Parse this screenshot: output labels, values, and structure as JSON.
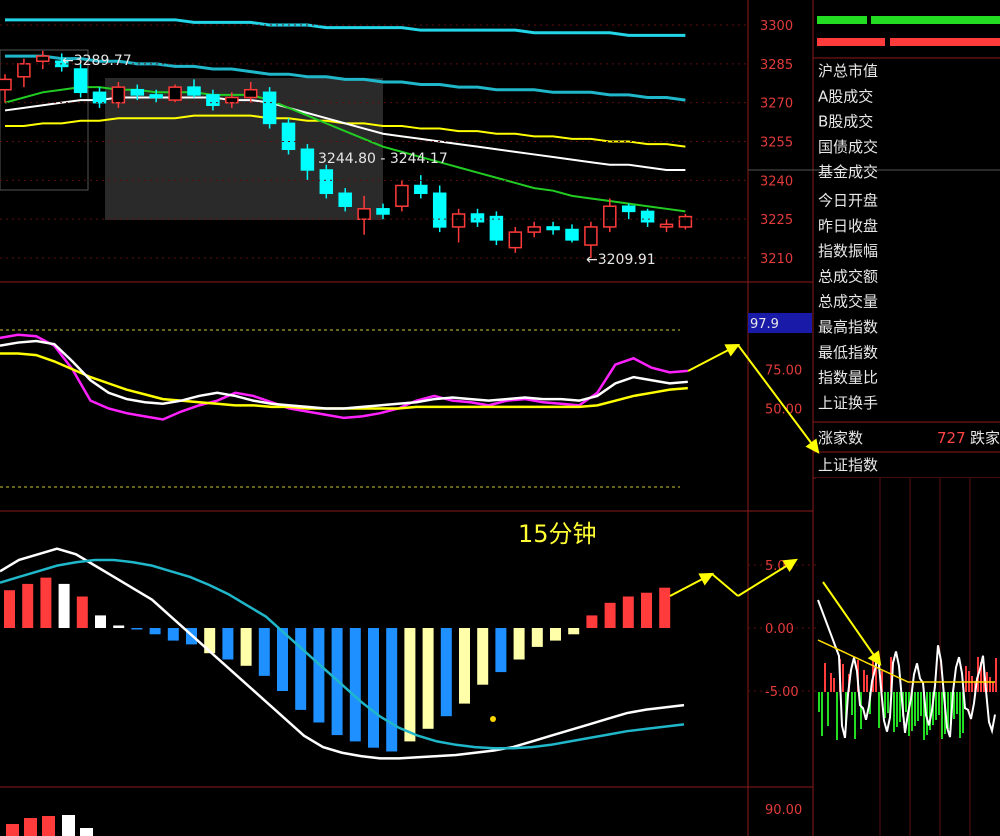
{
  "colors": {
    "grid": "#8b1a1a",
    "up": "#ff3b3b",
    "down": "#00ffff",
    "ma_white": "#ffffff",
    "ma_yellow": "#ffff00",
    "ma_green": "#22cc22",
    "ma_cyan": "#1fb7c9",
    "kdj_magenta": "#ff22ff",
    "macd_blue": "#1e90ff",
    "macd_paleyellow": "#ffffaa",
    "arrow_yellow": "#ffff00"
  },
  "price_axis": {
    "ticks": [
      "3300",
      "3285",
      "3270",
      "3255",
      "3240",
      "3225",
      "3210"
    ]
  },
  "annotations": {
    "high": "3289.77",
    "mid": "3244.80 - 3244.17",
    "low": "3209.91",
    "timeframe": "15分钟"
  },
  "kdj_axis": {
    "ticks": [
      "75.00",
      "50.00"
    ],
    "current": "97.9"
  },
  "macd_axis": {
    "ticks": [
      "5.00",
      "0.00",
      "-5.00"
    ]
  },
  "vol_axis": {
    "ticks": [
      "90.00"
    ]
  },
  "info_panel": {
    "rows": [
      "沪总市值",
      "A股成交",
      "B股成交",
      "国债成交",
      "基金成交",
      "今日开盘",
      "昨日收盘",
      "指数振幅",
      "总成交额",
      "总成交量",
      "最高指数",
      "最低指数",
      "指数量比",
      "上证换手"
    ],
    "rise_label": "涨家数",
    "rise_value": "727",
    "fall_label": "跌家",
    "mini_title": "上证指数"
  },
  "chart_data": [
    {
      "type": "candlestick",
      "title": "",
      "ylim": [
        3205,
        3305
      ],
      "candles": [
        {
          "o": 3275,
          "h": 3281,
          "l": 3270,
          "c": 3279
        },
        {
          "o": 3280,
          "h": 3287,
          "l": 3276,
          "c": 3285
        },
        {
          "o": 3286,
          "h": 3290,
          "l": 3283,
          "c": 3288
        },
        {
          "o": 3286,
          "h": 3289,
          "l": 3282,
          "c": 3284
        },
        {
          "o": 3283,
          "h": 3285,
          "l": 3272,
          "c": 3274
        },
        {
          "o": 3274,
          "h": 3276,
          "l": 3268,
          "c": 3270
        },
        {
          "o": 3270,
          "h": 3278,
          "l": 3268,
          "c": 3276
        },
        {
          "o": 3275,
          "h": 3277,
          "l": 3271,
          "c": 3273
        },
        {
          "o": 3273,
          "h": 3275,
          "l": 3270,
          "c": 3272
        },
        {
          "o": 3271,
          "h": 3277,
          "l": 3270,
          "c": 3276
        },
        {
          "o": 3276,
          "h": 3279,
          "l": 3272,
          "c": 3273
        },
        {
          "o": 3273,
          "h": 3275,
          "l": 3267,
          "c": 3269
        },
        {
          "o": 3270,
          "h": 3274,
          "l": 3268,
          "c": 3272
        },
        {
          "o": 3272,
          "h": 3278,
          "l": 3270,
          "c": 3275
        },
        {
          "o": 3274,
          "h": 3276,
          "l": 3260,
          "c": 3262
        },
        {
          "o": 3262,
          "h": 3264,
          "l": 3250,
          "c": 3252
        },
        {
          "o": 3252,
          "h": 3254,
          "l": 3240,
          "c": 3244
        },
        {
          "o": 3244,
          "h": 3246,
          "l": 3233,
          "c": 3235
        },
        {
          "o": 3235,
          "h": 3237,
          "l": 3228,
          "c": 3230
        },
        {
          "o": 3225,
          "h": 3234,
          "l": 3219,
          "c": 3229
        },
        {
          "o": 3229,
          "h": 3231,
          "l": 3225,
          "c": 3227
        },
        {
          "o": 3230,
          "h": 3240,
          "l": 3228,
          "c": 3238
        },
        {
          "o": 3238,
          "h": 3242,
          "l": 3233,
          "c": 3235
        },
        {
          "o": 3235,
          "h": 3238,
          "l": 3220,
          "c": 3222
        },
        {
          "o": 3222,
          "h": 3229,
          "l": 3216,
          "c": 3227
        },
        {
          "o": 3227,
          "h": 3229,
          "l": 3222,
          "c": 3224
        },
        {
          "o": 3226,
          "h": 3228,
          "l": 3215,
          "c": 3217
        },
        {
          "o": 3214,
          "h": 3222,
          "l": 3212,
          "c": 3220
        },
        {
          "o": 3220,
          "h": 3224,
          "l": 3218,
          "c": 3222
        },
        {
          "o": 3222,
          "h": 3224,
          "l": 3219,
          "c": 3221
        },
        {
          "o": 3221,
          "h": 3223,
          "l": 3216,
          "c": 3217
        },
        {
          "o": 3215,
          "h": 3224,
          "l": 3210,
          "c": 3222
        },
        {
          "o": 3222,
          "h": 3233,
          "l": 3220,
          "c": 3230
        },
        {
          "o": 3230,
          "h": 3231,
          "l": 3225,
          "c": 3228
        },
        {
          "o": 3228,
          "h": 3229,
          "l": 3222,
          "c": 3224
        },
        {
          "o": 3222,
          "h": 3225,
          "l": 3220,
          "c": 3223
        },
        {
          "o": 3222,
          "h": 3227,
          "l": 3221,
          "c": 3226
        }
      ],
      "ma_lines": [
        {
          "color": "cyan_top",
          "values": [
            3302,
            3302,
            3302,
            3302,
            3302,
            3302,
            3302,
            3302,
            3302,
            3302,
            3301,
            3301,
            3301,
            3301,
            3300,
            3300,
            3300,
            3299,
            3299,
            3299,
            3299,
            3299,
            3298,
            3298,
            3298,
            3298,
            3298,
            3298,
            3297,
            3297,
            3297,
            3297,
            3297,
            3296,
            3296,
            3296,
            3296
          ]
        },
        {
          "color": "cyan",
          "values": [
            3288,
            3288,
            3288,
            3287,
            3287,
            3286,
            3286,
            3285,
            3285,
            3284,
            3284,
            3283,
            3283,
            3282,
            3281,
            3281,
            3280,
            3280,
            3279,
            3279,
            3278,
            3278,
            3277,
            3277,
            3276,
            3276,
            3275,
            3275,
            3275,
            3274,
            3274,
            3274,
            3273,
            3273,
            3272,
            3272,
            3271
          ]
        },
        {
          "color": "yellow",
          "values": [
            3261,
            3261,
            3262,
            3262,
            3263,
            3263,
            3264,
            3264,
            3264,
            3264,
            3265,
            3265,
            3265,
            3265,
            3264,
            3264,
            3263,
            3263,
            3262,
            3262,
            3261,
            3261,
            3260,
            3260,
            3259,
            3259,
            3258,
            3258,
            3257,
            3257,
            3256,
            3256,
            3255,
            3255,
            3254,
            3254,
            3253
          ]
        },
        {
          "color": "white",
          "values": [
            3267,
            3268,
            3269,
            3270,
            3271,
            3271,
            3272,
            3272,
            3272,
            3272,
            3272,
            3272,
            3271,
            3271,
            3270,
            3268,
            3266,
            3264,
            3262,
            3260,
            3258,
            3257,
            3256,
            3255,
            3254,
            3253,
            3252,
            3251,
            3250,
            3249,
            3248,
            3247,
            3246,
            3246,
            3245,
            3244,
            3244
          ]
        },
        {
          "color": "green",
          "values": [
            3270,
            3272,
            3274,
            3275,
            3276,
            3276,
            3275,
            3275,
            3274,
            3274,
            3274,
            3273,
            3273,
            3273,
            3271,
            3268,
            3265,
            3262,
            3259,
            3256,
            3253,
            3251,
            3249,
            3247,
            3245,
            3243,
            3241,
            3239,
            3237,
            3236,
            3234,
            3233,
            3232,
            3231,
            3230,
            3229,
            3228
          ]
        }
      ]
    },
    {
      "type": "line",
      "title": "",
      "ylim": [
        0,
        100
      ],
      "series": [
        {
          "color": "magenta",
          "values": [
            95,
            97,
            96,
            90,
            75,
            55,
            50,
            47,
            45,
            43,
            48,
            52,
            55,
            60,
            58,
            54,
            50,
            48,
            46,
            44,
            45,
            47,
            50,
            55,
            58,
            55,
            54,
            52,
            55,
            56,
            54,
            53,
            52,
            60,
            78,
            82,
            76,
            73,
            74
          ]
        },
        {
          "color": "yellow",
          "values": [
            85,
            85,
            84,
            80,
            75,
            70,
            66,
            62,
            59,
            56,
            55,
            54,
            53,
            52,
            52,
            51,
            51,
            50,
            50,
            50,
            50,
            50,
            50,
            51,
            51,
            51,
            51,
            51,
            51,
            51,
            51,
            51,
            51,
            52,
            55,
            58,
            60,
            62,
            63
          ]
        },
        {
          "color": "white",
          "values": [
            90,
            92,
            93,
            91,
            80,
            68,
            60,
            56,
            54,
            53,
            55,
            58,
            60,
            58,
            55,
            53,
            52,
            51,
            50,
            50,
            51,
            52,
            53,
            54,
            56,
            57,
            56,
            55,
            56,
            57,
            56,
            56,
            55,
            58,
            66,
            70,
            68,
            66,
            67
          ]
        }
      ]
    },
    {
      "type": "bar",
      "title": "",
      "ylim": [
        -12,
        8
      ],
      "values": [
        3.0,
        3.5,
        4.0,
        3.5,
        2.5,
        1.0,
        0.2,
        0,
        -0.5,
        -1.0,
        -1.3,
        -2.0,
        -2.5,
        -3.0,
        -3.8,
        -5.0,
        -6.5,
        -7.5,
        -8.5,
        -9.0,
        -9.5,
        -9.8,
        -9.0,
        -8.0,
        -7.0,
        -6.0,
        -4.5,
        -3.5,
        -2.5,
        -1.5,
        -1.0,
        -0.5,
        1.0,
        2.0,
        2.5,
        2.8,
        3.2
      ],
      "signal_lines": [
        {
          "color": "white",
          "values": [
            5,
            6,
            6.5,
            7,
            6.5,
            5.5,
            4.5,
            3.5,
            2.5,
            1.0,
            -0.5,
            -2,
            -3.5,
            -5,
            -6.5,
            -8,
            -9.5,
            -10.5,
            -11,
            -11.3,
            -11.5,
            -11.5,
            -11.4,
            -11.3,
            -11.2,
            -11,
            -10.8,
            -10.5,
            -10,
            -9.5,
            -9,
            -8.5,
            -8,
            -7.5,
            -7.2,
            -7,
            -6.8
          ]
        },
        {
          "color": "cyan",
          "values": [
            4,
            4.5,
            5,
            5.5,
            5.8,
            6,
            6,
            5.8,
            5.5,
            5,
            4.5,
            3.8,
            3,
            2,
            1,
            -0.5,
            -2,
            -3.5,
            -5,
            -6.5,
            -7.8,
            -8.8,
            -9.5,
            -10,
            -10.3,
            -10.5,
            -10.6,
            -10.6,
            -10.5,
            -10.3,
            -10,
            -9.7,
            -9.4,
            -9.1,
            -8.9,
            -8.7,
            -8.5
          ]
        }
      ]
    }
  ]
}
